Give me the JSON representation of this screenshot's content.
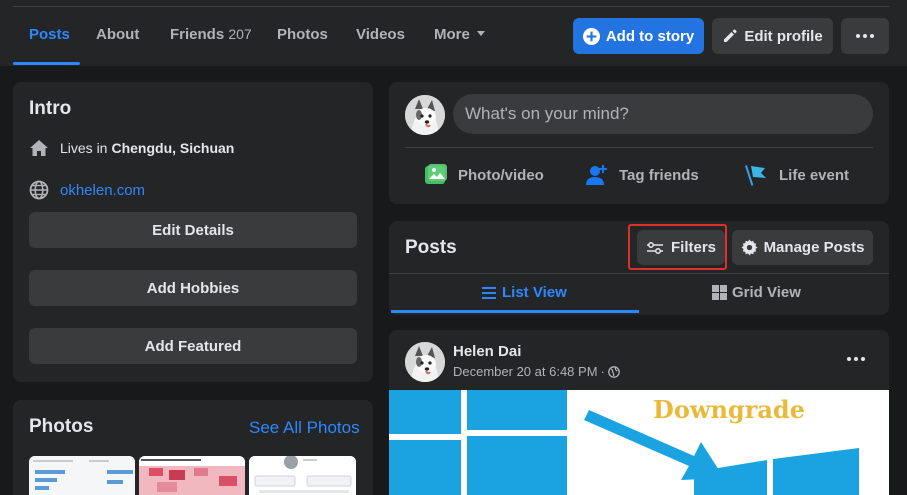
{
  "nav": {
    "tabs": [
      {
        "label": "Posts"
      },
      {
        "label": "About"
      },
      {
        "label": "Friends",
        "count": "207"
      },
      {
        "label": "Photos"
      },
      {
        "label": "Videos"
      },
      {
        "label": "More"
      }
    ],
    "add_story": "Add to story",
    "edit_profile": "Edit profile"
  },
  "intro": {
    "title": "Intro",
    "lives_prefix": "Lives in",
    "lives_city": "Chengdu, Sichuan",
    "website": "okhelen.com",
    "edit_details": "Edit Details",
    "add_hobbies": "Add Hobbies",
    "add_featured": "Add Featured"
  },
  "photos": {
    "title": "Photos",
    "see_all": "See All Photos"
  },
  "composer": {
    "placeholder": "What's on your mind?",
    "photo_video": "Photo/video",
    "tag_friends": "Tag friends",
    "life_event": "Life event"
  },
  "posts_panel": {
    "title": "Posts",
    "filters": "Filters",
    "manage_posts": "Manage Posts",
    "list_view": "List View",
    "grid_view": "Grid View"
  },
  "post": {
    "author": "Helen Dai",
    "time": "December 20 at 6:48 PM",
    "separator": "·",
    "image_caption": "Downgrade"
  },
  "colors": {
    "background": "#18191a",
    "card": "#242526",
    "accent": "#2d88ff",
    "button_blue": "#2374e1",
    "highlight": "#e0302b"
  },
  "icons": [
    "plus-circle-icon",
    "pencil-icon",
    "more-dots-icon",
    "home-icon",
    "globe-icon",
    "photo-icon",
    "tag-friends-icon",
    "flag-icon",
    "filters-icon",
    "gear-icon",
    "list-icon",
    "grid-icon",
    "public-globe-icon"
  ]
}
